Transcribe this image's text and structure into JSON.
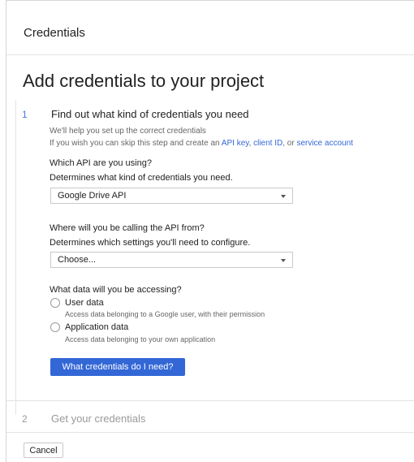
{
  "header": {
    "title": "Credentials"
  },
  "page": {
    "title": "Add credentials to your project"
  },
  "step1": {
    "number": "1",
    "title": "Find out what kind of credentials you need",
    "help_line1": "We'll help you set up the correct credentials",
    "help_line2_prefix": "If you wish you can skip this step and create an ",
    "link_api_key": "API key",
    "sep1": ", ",
    "link_client_id": "client ID",
    "sep2": ", or ",
    "link_service_account": "service account",
    "q_api": "Which API are you using?",
    "q_api_desc": "Determines what kind of credentials you need.",
    "api_select_value": "Google Drive API",
    "q_where": "Where will you be calling the API from?",
    "q_where_desc": "Determines which settings you'll need to configure.",
    "where_select_value": "Choose...",
    "q_data": "What data will you be accessing?",
    "options": [
      {
        "label": "User data",
        "desc": "Access data belonging to a Google user, with their permission"
      },
      {
        "label": "Application data",
        "desc": "Access data belonging to your own application"
      }
    ],
    "button": "What credentials do I need?"
  },
  "step2": {
    "number": "2",
    "title": "Get your credentials"
  },
  "cancel": "Cancel"
}
